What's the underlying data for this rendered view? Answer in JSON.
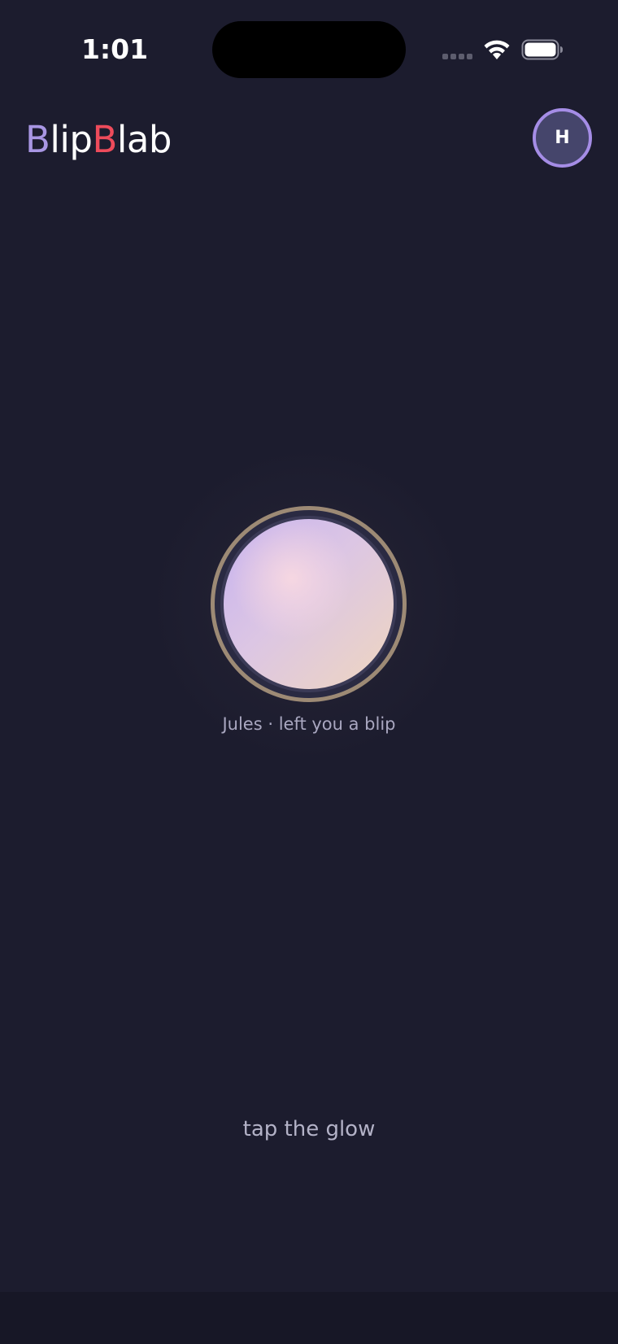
{
  "status_bar": {
    "time": "1:01"
  },
  "header": {
    "logo_part_1": "B",
    "logo_part_2": "lip",
    "logo_part_3": "B",
    "logo_part_4": "lab",
    "avatar_initial": "H"
  },
  "blip": {
    "caption": "Jules · left you a blip"
  },
  "hint": "tap the glow",
  "colors": {
    "background": "#1c1c2e",
    "logo_accent_purple": "#a896e3",
    "logo_accent_red": "#ee4b5b",
    "avatar_border": "#a58de6",
    "orb_ring": "#9d8a75"
  },
  "icons": {
    "signal": "cellular-signal-icon",
    "wifi": "wifi-icon",
    "battery": "battery-icon"
  }
}
